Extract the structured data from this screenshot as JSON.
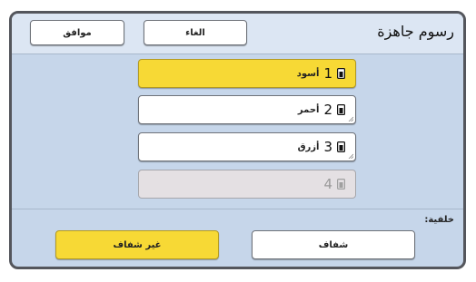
{
  "dialog": {
    "title": "رسوم جاهزة",
    "ok_label": "موافق",
    "cancel_label": "الغاء"
  },
  "slots": [
    {
      "number": "1",
      "name": "أسود",
      "state": "selected"
    },
    {
      "number": "2",
      "name": "أحمر",
      "state": "normal"
    },
    {
      "number": "3",
      "name": "أزرق",
      "state": "normal"
    },
    {
      "number": "4",
      "name": "",
      "state": "disabled"
    }
  ],
  "background": {
    "label": "خلفية:",
    "options": [
      "شفاف",
      "غير شفاف"
    ],
    "selected": "غير شفاف"
  },
  "colors": {
    "selected": "#f7d935",
    "panel": "#c6d6ea",
    "header": "#dce6f3",
    "disabled": "#e4e0e3"
  },
  "icons": {
    "slot": "ink-drum-icon",
    "resize": "resize-handle-icon"
  }
}
